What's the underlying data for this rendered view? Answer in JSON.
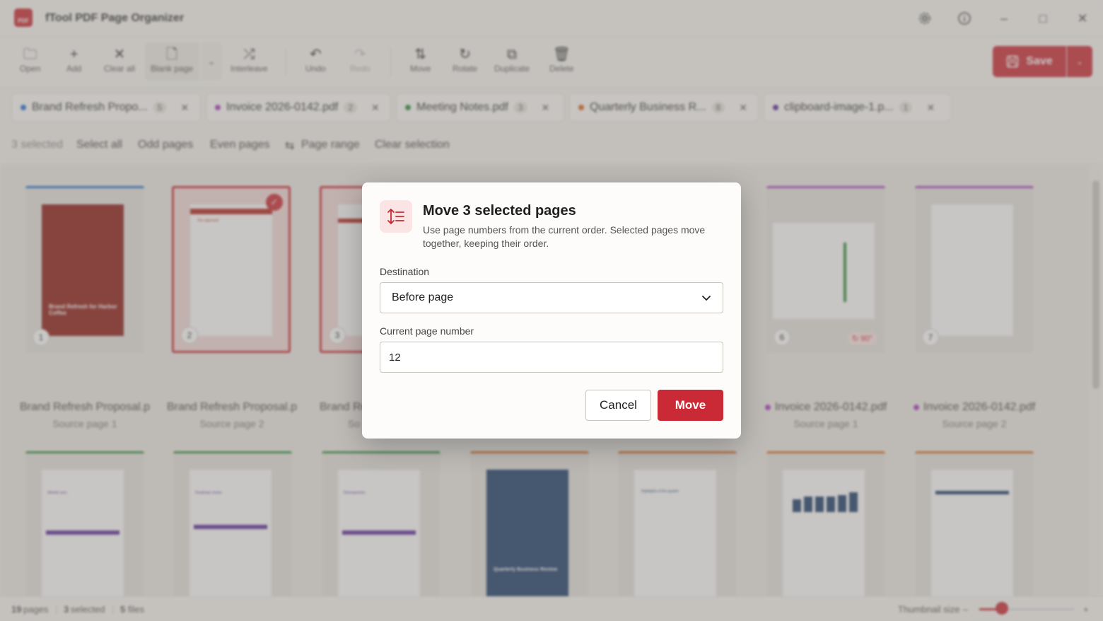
{
  "app": {
    "title": "fTool PDF Page Organizer",
    "logo_text": "PDF"
  },
  "window_controls": {
    "settings_icon": "gear-icon",
    "info_icon": "info-icon",
    "minimize": "–",
    "maximize": "□",
    "close": "✕"
  },
  "toolbar": {
    "open": "Open",
    "add": "Add",
    "clear_all": "Clear all",
    "blank_page": "Blank page",
    "interleave": "Interleave",
    "undo": "Undo",
    "redo": "Redo",
    "move": "Move",
    "rotate": "Rotate",
    "duplicate": "Duplicate",
    "delete": "Delete",
    "save": "Save"
  },
  "file_tabs": [
    {
      "name": "Brand Refresh Propo...",
      "count": "5",
      "color": "#1f6fd1"
    },
    {
      "name": "Invoice 2026-0142.pdf",
      "count": "2",
      "color": "#a83dbf"
    },
    {
      "name": "Meeting Notes.pdf",
      "count": "3",
      "color": "#2c8a3a"
    },
    {
      "name": "Quarterly Business R...",
      "count": "8",
      "color": "#d8651f"
    },
    {
      "name": "clipboard-image-1.p...",
      "count": "1",
      "color": "#5b2d9a"
    }
  ],
  "selection_bar": {
    "count": "3 selected",
    "select_all": "Select all",
    "odd_pages": "Odd pages",
    "even_pages": "Even pages",
    "page_range": "Page range",
    "clear_selection": "Clear selection"
  },
  "thumbnails_row1": [
    {
      "num": "1",
      "file": "Brand Refresh Proposal.p",
      "source": "Source page 1"
    },
    {
      "num": "2",
      "file": "Brand Refresh Proposal.p",
      "source": "Source page 2"
    },
    {
      "num": "3",
      "file": "Brand Re",
      "source": "So"
    },
    {
      "num": "6",
      "file": "Invoice 2026-0142.pdf",
      "source": "Source page 1",
      "rotation": "↻ 90°"
    },
    {
      "num": "7",
      "file": "Invoice 2026-0142.pdf",
      "source": "Source page 2"
    }
  ],
  "thumbnail_texts": {
    "brand_cover": "Brand Refresh for Harbor Coffee",
    "our_approach": "Our approach",
    "weekly_sync": "Weekly sync",
    "roadmap_review": "Roadmap review",
    "retrospective": "Retrospective",
    "qbr_cover": "Quarterly Business Review",
    "highlights": "Highlights of the quarter"
  },
  "status_bar": {
    "pages_count": "19",
    "pages_label": "pages",
    "selected_count": "3",
    "selected_label": "selected",
    "files_count": "5",
    "files_label": "files",
    "thumb_size_label": "Thumbnail size",
    "thumb_size_value": 0.25,
    "minus": "–",
    "plus": "+"
  },
  "modal": {
    "title": "Move 3 selected pages",
    "description": "Use page numbers from the current order. Selected pages move together, keeping their order.",
    "destination_label": "Destination",
    "destination_value": "Before page",
    "page_number_label": "Current page number",
    "page_number_value": "12",
    "cancel": "Cancel",
    "confirm": "Move"
  },
  "colors": {
    "accent": "#c92a35"
  }
}
